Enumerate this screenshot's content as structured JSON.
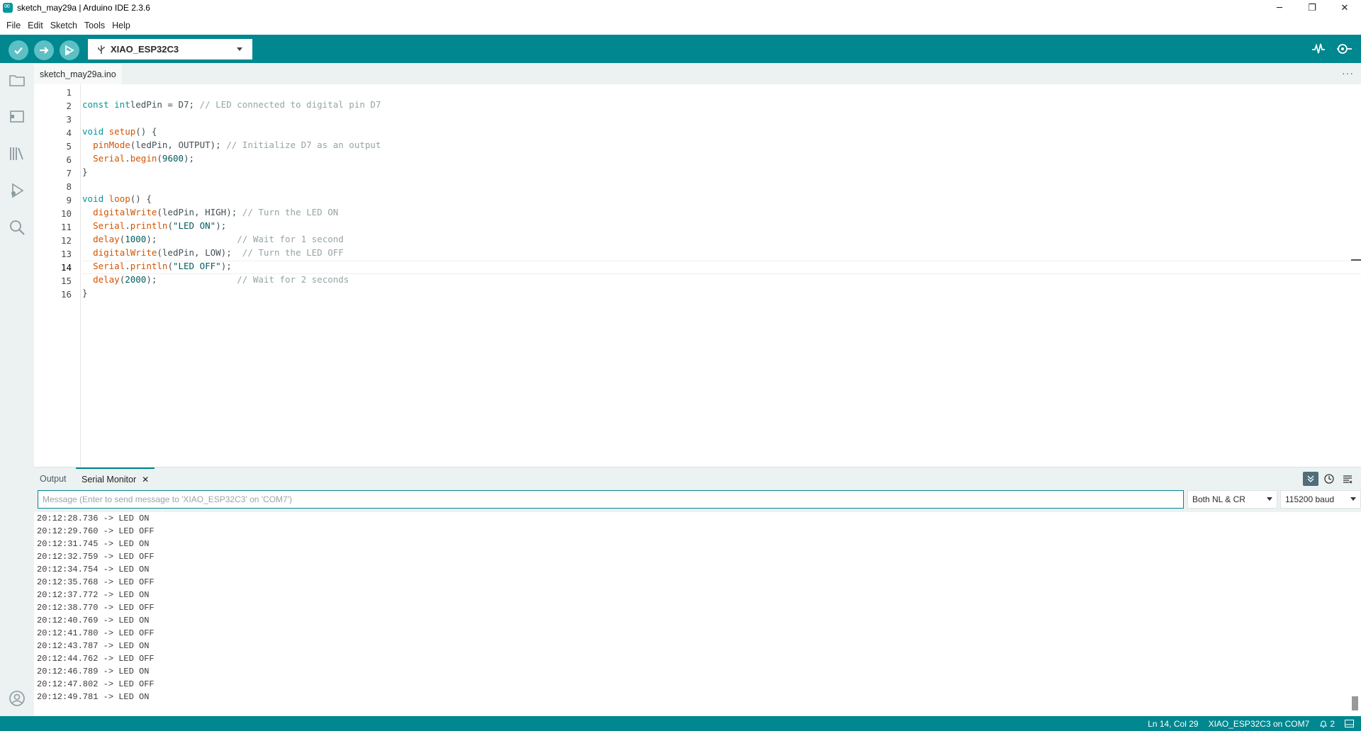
{
  "window": {
    "title": "sketch_may29a | Arduino IDE 2.3.6",
    "minimize": "─",
    "restore": "❐",
    "close": "✕"
  },
  "menu": [
    "File",
    "Edit",
    "Sketch",
    "Tools",
    "Help"
  ],
  "toolbar": {
    "board": "XIAO_ESP32C3",
    "verify_icon": "check-icon",
    "upload_icon": "arrow-right-icon",
    "debug_icon": "debug-icon",
    "plotter_icon": "serial-plotter-icon",
    "monitor_icon": "serial-monitor-icon"
  },
  "sidebar": [
    "folder-icon",
    "board-manager-icon",
    "library-icon",
    "debug-icon",
    "search-icon",
    "account-icon"
  ],
  "file_tab": "sketch_may29a.ino",
  "editor": {
    "active_line": 14,
    "line_numbers": [
      "1",
      "2",
      "3",
      "4",
      "5",
      "6",
      "7",
      "8",
      "9",
      "10",
      "11",
      "12",
      "13",
      "14",
      "15",
      "16"
    ]
  },
  "code": [
    [],
    [
      [
        "kw",
        "const int"
      ],
      [
        "",
        "ledPin = D7; "
      ],
      [
        "cmt",
        "// LED connected to digital pin D7"
      ]
    ],
    [],
    [
      [
        "kw",
        "void"
      ],
      [
        "fn",
        " setup"
      ],
      [
        "",
        "() {"
      ]
    ],
    [
      [
        "",
        "  "
      ],
      [
        "fn",
        "pinMode"
      ],
      [
        "",
        "(ledPin, OUTPUT); "
      ],
      [
        "cmt",
        "// Initialize D7 as an output"
      ]
    ],
    [
      [
        "",
        "  "
      ],
      [
        "fn",
        "Serial"
      ],
      [
        "",
        "."
      ],
      [
        "fn",
        "begin"
      ],
      [
        "",
        "("
      ],
      [
        "num",
        "9600"
      ],
      [
        "",
        ");"
      ]
    ],
    [
      [
        "",
        "}"
      ]
    ],
    [],
    [
      [
        "kw",
        "void"
      ],
      [
        "fn",
        " loop"
      ],
      [
        "",
        "() {"
      ]
    ],
    [
      [
        "",
        "  "
      ],
      [
        "fn",
        "digitalWrite"
      ],
      [
        "",
        "(ledPin, HIGH); "
      ],
      [
        "cmt",
        "// Turn the LED ON"
      ]
    ],
    [
      [
        "",
        "  "
      ],
      [
        "fn",
        "Serial"
      ],
      [
        "",
        "."
      ],
      [
        "fn",
        "println"
      ],
      [
        "",
        "("
      ],
      [
        "str",
        "\"LED ON\""
      ],
      [
        "",
        ");"
      ]
    ],
    [
      [
        "",
        "  "
      ],
      [
        "fn",
        "delay"
      ],
      [
        "",
        "("
      ],
      [
        "num",
        "1000"
      ],
      [
        "",
        ");               "
      ],
      [
        "cmt",
        "// Wait for 1 second"
      ]
    ],
    [
      [
        "",
        "  "
      ],
      [
        "fn",
        "digitalWrite"
      ],
      [
        "",
        "(ledPin, LOW);  "
      ],
      [
        "cmt",
        "// Turn the LED OFF"
      ]
    ],
    [
      [
        "",
        "  "
      ],
      [
        "fn",
        "Serial"
      ],
      [
        "",
        "."
      ],
      [
        "fn",
        "println"
      ],
      [
        "",
        "("
      ],
      [
        "str",
        "\"LED OFF\""
      ],
      [
        "",
        ");"
      ]
    ],
    [
      [
        "",
        "  "
      ],
      [
        "fn",
        "delay"
      ],
      [
        "",
        "("
      ],
      [
        "num",
        "2000"
      ],
      [
        "",
        ");               "
      ],
      [
        "cmt",
        "// Wait for 2 seconds"
      ]
    ],
    [
      [
        "",
        "}"
      ]
    ]
  ],
  "panel": {
    "tab_output": "Output",
    "tab_serial": "Serial Monitor",
    "close": "✕",
    "autoscroll_icon": "autoscroll-icon",
    "timestamp_icon": "timestamp-icon",
    "clear_icon": "clear-output-icon"
  },
  "serial": {
    "placeholder": "Message (Enter to send message to 'XIAO_ESP32C3' on 'COM7')",
    "line_ending": "Both NL & CR",
    "baud": "115200 baud",
    "output": [
      "20:12:28.736 -> LED ON",
      "20:12:29.760 -> LED OFF",
      "20:12:31.745 -> LED ON",
      "20:12:32.759 -> LED OFF",
      "20:12:34.754 -> LED ON",
      "20:12:35.768 -> LED OFF",
      "20:12:37.772 -> LED ON",
      "20:12:38.770 -> LED OFF",
      "20:12:40.769 -> LED ON",
      "20:12:41.780 -> LED OFF",
      "20:12:43.787 -> LED ON",
      "20:12:44.762 -> LED OFF",
      "20:12:46.789 -> LED ON",
      "20:12:47.802 -> LED OFF",
      "20:12:49.781 -> LED ON"
    ]
  },
  "status": {
    "position": "Ln 14, Col 29",
    "board_port": "XIAO_ESP32C3 on COM7",
    "notifications": "2",
    "notification_icon": "bell-icon",
    "panel_icon": "toggle-panel-icon"
  },
  "colors": {
    "accent": "#00878f",
    "keyword": "#00979d",
    "function": "#d35400",
    "comment": "#95a5a6"
  }
}
